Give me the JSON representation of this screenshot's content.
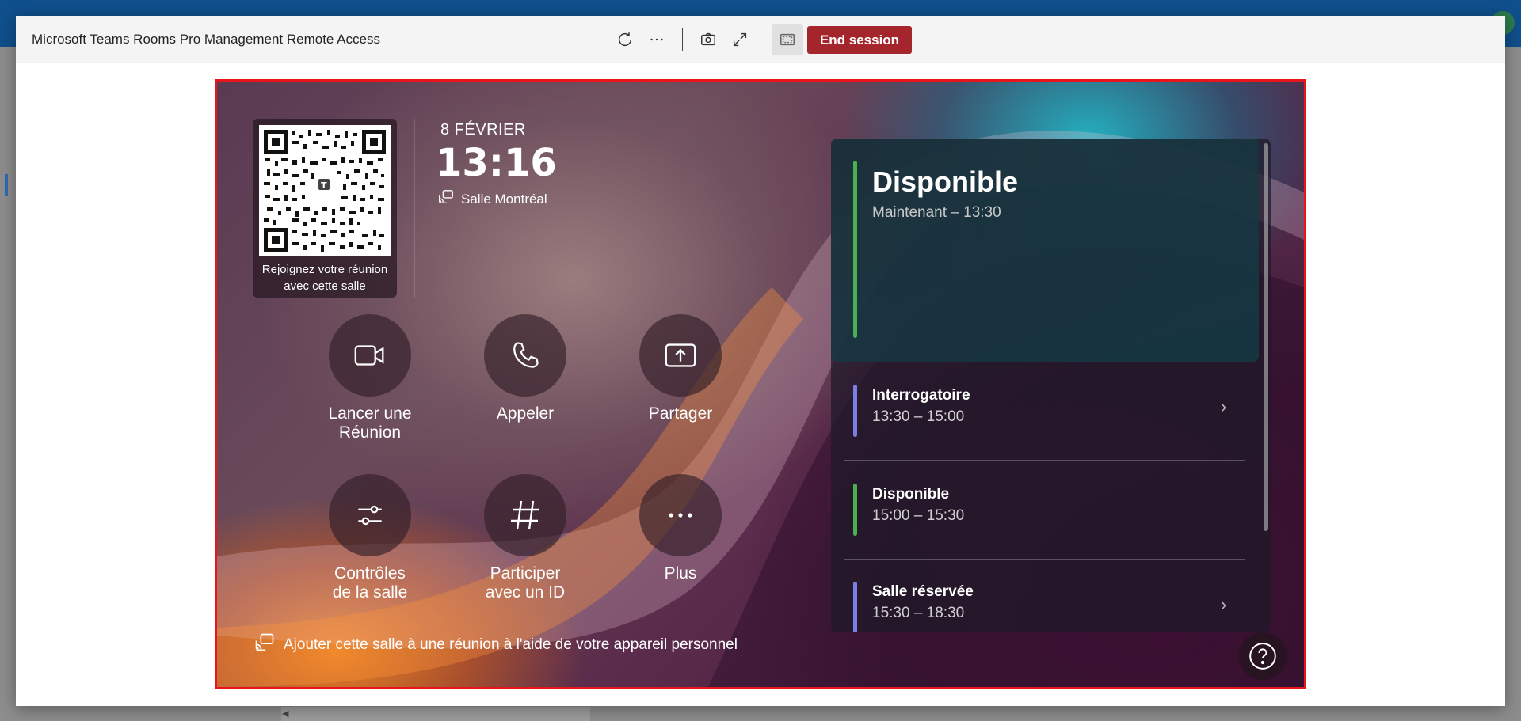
{
  "window": {
    "title": "Microsoft Teams Rooms Pro Management Remote Access",
    "end_session_label": "End session"
  },
  "device": {
    "date": "8 FÉVRIER",
    "time": "13:16",
    "room_name": "Salle Montréal",
    "qr_caption_line1": "Rejoignez votre réunion",
    "qr_caption_line2": "avec cette salle",
    "actions": [
      {
        "label": "Lancer une\nRéunion",
        "icon": "video-camera-icon"
      },
      {
        "label": "Appeler",
        "icon": "phone-icon"
      },
      {
        "label": "Partager",
        "icon": "share-screen-icon"
      },
      {
        "label": "Contrôles\nde la salle",
        "icon": "sliders-icon"
      },
      {
        "label": "Participer\navec un ID",
        "icon": "hash-icon"
      },
      {
        "label": "Plus",
        "icon": "more-dots-icon"
      }
    ],
    "bottom_note": "Ajouter cette salle à une réunion à l'aide de votre appareil personnel"
  },
  "schedule": {
    "current": {
      "title": "Disponible",
      "time": "Maintenant – 13:30"
    },
    "slots": [
      {
        "title": "Interrogatoire",
        "time": "13:30 – 15:00",
        "color": "#7b7fe8",
        "chevron": true
      },
      {
        "title": "Disponible",
        "time": "15:00 – 15:30",
        "color": "#4caf50",
        "chevron": false
      },
      {
        "title": "Salle réservée",
        "time": "15:30 – 18:30",
        "color": "#7b7fe8",
        "chevron": true
      }
    ]
  },
  "colors": {
    "end_session": "#a4262c",
    "screen_border": "#e8161b",
    "available": "#4caf50",
    "meeting": "#7b7fe8"
  }
}
